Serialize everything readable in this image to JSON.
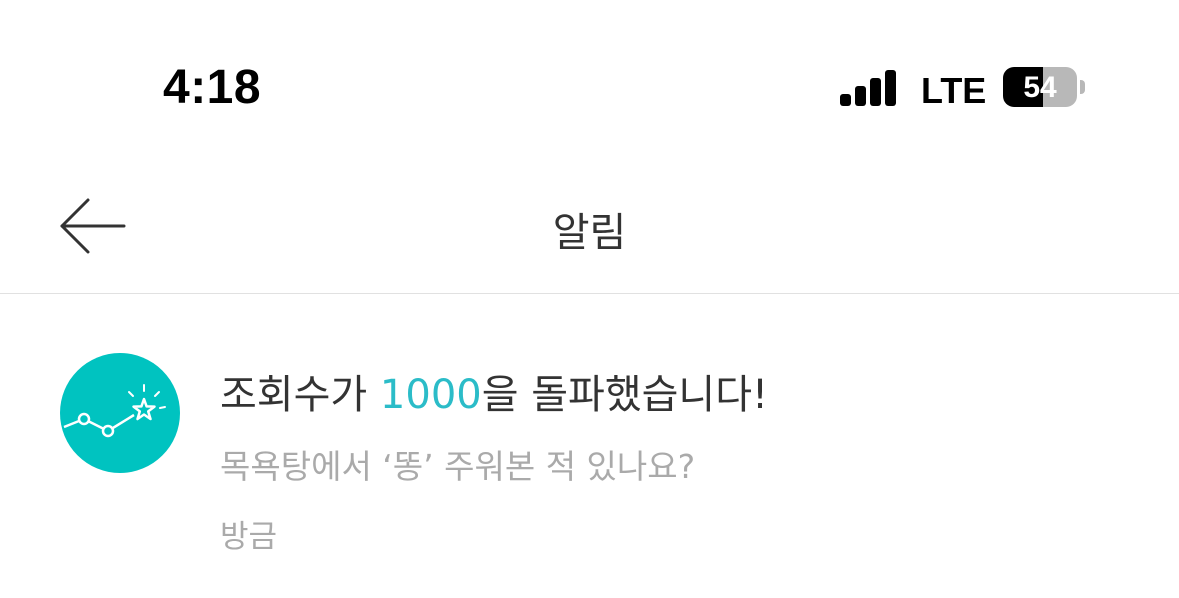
{
  "status_bar": {
    "time": "4:18",
    "network": "LTE",
    "battery": "54",
    "battery_level": 0.54,
    "icons": [
      "signal-icon",
      "battery-icon"
    ]
  },
  "header": {
    "title": "알림",
    "back_icon": "arrow-left-icon"
  },
  "notification": {
    "icon": "chart-star-icon",
    "icon_color": "#00c3c0",
    "title_prefix": "조회수가 ",
    "title_highlight": "1000",
    "title_suffix": "을 돌파했습니다!",
    "highlight_color": "#2bbcc8",
    "subtitle": "목욕탕에서 ‘똥’ 주워본 적 있나요?",
    "time": "방금"
  }
}
